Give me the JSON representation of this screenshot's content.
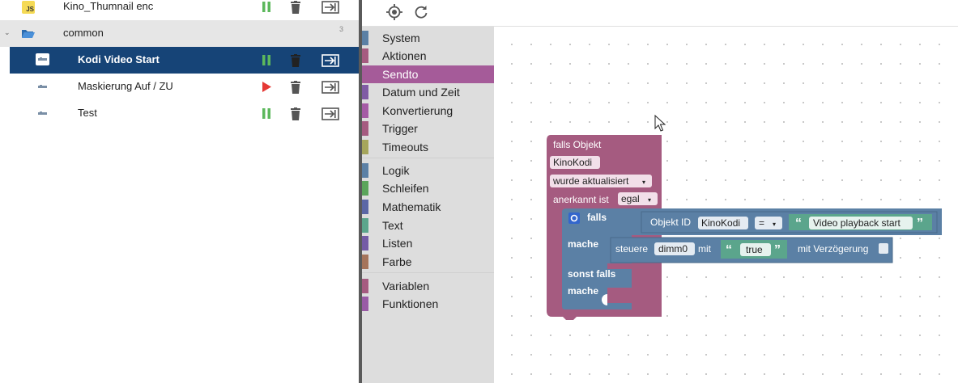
{
  "tree": {
    "items": [
      {
        "label": "Kino_Thumnail enc",
        "icon": "js-file-icon",
        "status": "running"
      },
      {
        "label": "common",
        "icon": "folder-open-icon",
        "count": "3"
      },
      {
        "label": "Kodi Video Start",
        "icon": "blockly-script-icon",
        "status": "running",
        "selected": true
      },
      {
        "label": "Maskierung Auf / ZU",
        "icon": "blockly-script-icon",
        "status": "stopped"
      },
      {
        "label": "Test",
        "icon": "blockly-script-icon",
        "status": "running"
      }
    ]
  },
  "toolbar": {
    "icons": [
      "center-target-icon",
      "refresh-icon"
    ]
  },
  "toolbox": {
    "categories": [
      {
        "label": "System",
        "color": "#5b80a5"
      },
      {
        "label": "Aktionen",
        "color": "#a55b80"
      },
      {
        "label": "Sendto",
        "color": "#a55b99",
        "selected": true
      },
      {
        "label": "Datum und Zeit",
        "color": "#805ba5"
      },
      {
        "label": "Konvertierung",
        "color": "#a55ba5"
      },
      {
        "label": "Trigger",
        "color": "#a55b80"
      },
      {
        "label": "Timeouts",
        "color": "#a5a55b"
      },
      {
        "label": "Logik",
        "color": "#5b80a5"
      },
      {
        "label": "Schleifen",
        "color": "#5ba55b"
      },
      {
        "label": "Mathematik",
        "color": "#5b67a5"
      },
      {
        "label": "Text",
        "color": "#5ba58c"
      },
      {
        "label": "Listen",
        "color": "#745ba5"
      },
      {
        "label": "Farbe",
        "color": "#a5745b"
      },
      {
        "label": "Variablen",
        "color": "#a55b80"
      },
      {
        "label": "Funktionen",
        "color": "#995ba5"
      }
    ]
  },
  "blocks": {
    "trigger": {
      "title": "falls Objekt",
      "object": "KinoKodi",
      "event": "wurde aktualisiert",
      "ack_label": "anerkannt ist",
      "ack_value": "egal"
    },
    "if": {
      "falls": "falls",
      "mache": "mache",
      "sonst_falls": "sonst falls",
      "mache2": "mache"
    },
    "compare": {
      "label": "Objekt ID",
      "object": "KinoKodi",
      "op": "=",
      "text": "Video playback start"
    },
    "control": {
      "label": "steuere",
      "target": "dimm0",
      "mit": "mit",
      "value": "true",
      "delay_label": "mit Verzögerung"
    }
  },
  "colors": {
    "trigger_block": "#a55b80",
    "logic_block": "#5b80a5",
    "text_block": "#5ba58c",
    "selection": "#164477",
    "run_green": "#5cb85c",
    "stop_red": "#e53935"
  }
}
